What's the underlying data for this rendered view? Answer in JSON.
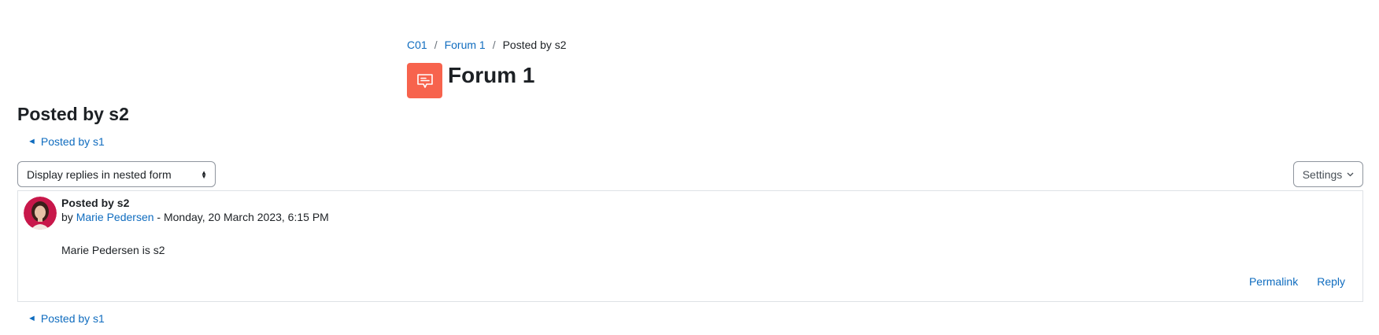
{
  "breadcrumb": {
    "items": [
      {
        "label": "C01"
      },
      {
        "label": "Forum 1"
      },
      {
        "label": "Posted by s2"
      }
    ],
    "separator": "/"
  },
  "header": {
    "icon": "forum-icon",
    "icon_color": "#f7634d",
    "title": "Forum 1"
  },
  "discussion": {
    "title": "Posted by s2",
    "prev_link_top": "Posted by s1",
    "prev_link_bottom": "Posted by s1",
    "display_mode": {
      "selected": "Display replies in nested form"
    },
    "settings_label": "Settings"
  },
  "post": {
    "subject": "Posted by s2",
    "by_prefix": "by",
    "author": "Marie Pedersen",
    "date": " - Monday, 20 March 2023, 6:15 PM",
    "message": "Marie Pedersen is s2",
    "actions": {
      "permalink": "Permalink",
      "reply": "Reply"
    }
  },
  "colors": {
    "link": "#0f6cbf",
    "border": "#dee2e6"
  }
}
